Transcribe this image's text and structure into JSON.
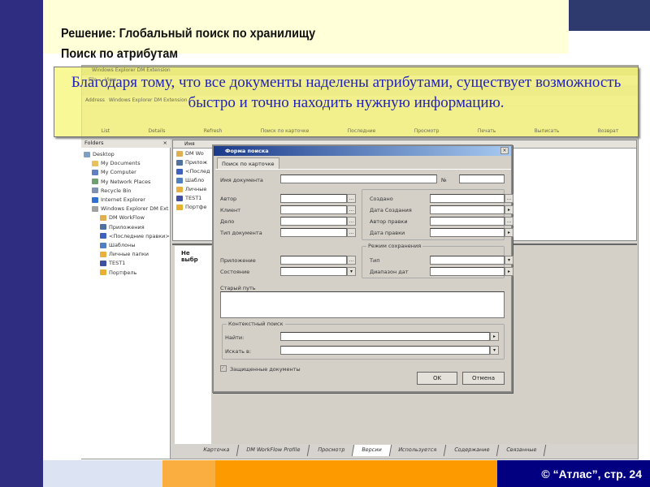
{
  "slide": {
    "title1": "Решение: Глобальный поиск по хранилищу",
    "title2": "Поиск по атрибутам",
    "note": "Благодаря тому, что все документы наделены атрибутами, существует возможность быстро и точно находить нужную информацию.",
    "footer": "© “Атлас”, стр. 24"
  },
  "window": {
    "title": "Windows Explorer DM Extension",
    "menu": [
      "File",
      "View"
    ],
    "address_label": "Address",
    "address": "Windows Explorer DM Extension",
    "toolbar": [
      "List",
      "Details",
      "Refresh",
      "Поиск по карточке",
      "Последние",
      "Просмотр",
      "Печать",
      "Выписать",
      "Возврат"
    ],
    "folders_label": "Folders",
    "tree": [
      "Desktop",
      "My Documents",
      "My Computer",
      "My Network Places",
      "Recycle Bin",
      "Internet Explorer",
      "Windows Explorer DM Ext",
      "DM WorkFlow",
      "Приложения",
      "<Последние правки>",
      "Шаблоны",
      "Личные папки",
      "TEST1",
      "Портфель"
    ],
    "list_header": "Имя",
    "list": [
      "DM Wo",
      "Прилож",
      "<Послед",
      "Шабло",
      "Личные",
      "TEST1",
      "Портфе"
    ],
    "not_selected": "Не выбр",
    "tabs": [
      "Карточка",
      "DM WorkFlow Profile",
      "Просмотр",
      "Версии",
      "Используется",
      "Содержание",
      "Связанные"
    ],
    "active_tab": "Версии"
  },
  "dialog": {
    "title": "Форма поиска",
    "tab": "Поиск по карточке",
    "doc_name": "Имя документа",
    "number": "№",
    "left": [
      "Автор",
      "Клиент",
      "Дело",
      "Тип документа"
    ],
    "right": [
      "Создано",
      "Дата Создания",
      "Автор правки",
      "Дата правки"
    ],
    "save_mode": "Режим сохранения",
    "app": "Приложение",
    "state": "Состояние",
    "type": "Тип",
    "date_range": "Диапазон дат",
    "old_path": "Старый путь",
    "context": "Контекстный поиск",
    "find": "Найти:",
    "search_in": "Искать в:",
    "protected": "Защищенные документы",
    "protected_checked": true,
    "ok": "OK",
    "cancel": "Отмена"
  }
}
